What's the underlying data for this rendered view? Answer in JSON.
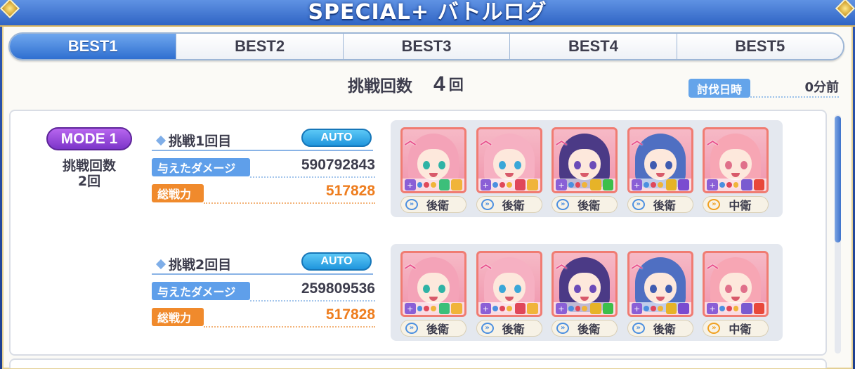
{
  "header": {
    "title": "SPECIAL+ バトルログ"
  },
  "tabs": [
    {
      "label": "BEST1",
      "active": true
    },
    {
      "label": "BEST2",
      "active": false
    },
    {
      "label": "BEST3",
      "active": false
    },
    {
      "label": "BEST4",
      "active": false
    },
    {
      "label": "BEST5",
      "active": false
    }
  ],
  "summary": {
    "attempts_label": "挑戦回数",
    "attempts_value": "4",
    "attempts_unit": "回",
    "date_label": "討伐日時",
    "date_value": "0分前"
  },
  "mode": {
    "badge": "MODE 1",
    "count_label": "挑戦回数",
    "count_value": "2回"
  },
  "runs": [
    {
      "title": "挑戦1回目",
      "auto_label": "AUTO",
      "damage_label": "与えたダメージ",
      "damage_value": "590792843",
      "power_label": "総戦力",
      "power_value": "517828",
      "party": [
        {
          "position": "後衛",
          "hair": "#f4a3b8",
          "eyes": "#2fb3a5",
          "icons": [
            "chat-heart",
            "sun"
          ],
          "icon_colors": [
            "#3cbf7a",
            "#f0b43a"
          ],
          "arrow": "blue"
        },
        {
          "position": "後衛",
          "hair": "#f6b0c2",
          "eyes": "#3aa7d8",
          "icons": [
            "slash",
            "sun"
          ],
          "icon_colors": [
            "#e0475a",
            "#f0b43a"
          ],
          "arrow": "blue"
        },
        {
          "position": "後衛",
          "hair": "#4b3a86",
          "eyes": "#6b4bb8",
          "icons": [
            "flask",
            "wind"
          ],
          "icon_colors": [
            "#e6b328",
            "#3cbf4a"
          ],
          "arrow": "blue"
        },
        {
          "position": "後衛",
          "hair": "#4f6fc2",
          "eyes": "#3f5bb0",
          "icons": [
            "flask",
            "moon"
          ],
          "icon_colors": [
            "#e6b328",
            "#7a4bd0"
          ],
          "arrow": "blue"
        },
        {
          "position": "中衛",
          "hair": "#f7a6b4",
          "eyes": "#e0708a",
          "icons": [
            "shield",
            "fire"
          ],
          "icon_colors": [
            "#7a5bd0",
            "#e8483a"
          ],
          "arrow": "orange"
        }
      ]
    },
    {
      "title": "挑戦2回目",
      "auto_label": "AUTO",
      "damage_label": "与えたダメージ",
      "damage_value": "259809536",
      "power_label": "総戦力",
      "power_value": "517828",
      "party": [
        {
          "position": "後衛",
          "hair": "#f4a3b8",
          "eyes": "#2fb3a5",
          "icons": [
            "chat-heart",
            "sun"
          ],
          "icon_colors": [
            "#3cbf7a",
            "#f0b43a"
          ],
          "arrow": "blue"
        },
        {
          "position": "後衛",
          "hair": "#f6b0c2",
          "eyes": "#3aa7d8",
          "icons": [
            "slash",
            "sun"
          ],
          "icon_colors": [
            "#e0475a",
            "#f0b43a"
          ],
          "arrow": "blue"
        },
        {
          "position": "後衛",
          "hair": "#4b3a86",
          "eyes": "#6b4bb8",
          "icons": [
            "flask",
            "wind"
          ],
          "icon_colors": [
            "#e6b328",
            "#3cbf4a"
          ],
          "arrow": "blue"
        },
        {
          "position": "後衛",
          "hair": "#4f6fc2",
          "eyes": "#3f5bb0",
          "icons": [
            "flask",
            "moon"
          ],
          "icon_colors": [
            "#e6b328",
            "#7a4bd0"
          ],
          "arrow": "blue"
        },
        {
          "position": "中衛",
          "hair": "#f7a6b4",
          "eyes": "#e0708a",
          "icons": [
            "shield",
            "fire"
          ],
          "icon_colors": [
            "#7a5bd0",
            "#e8483a"
          ],
          "arrow": "orange"
        }
      ]
    }
  ],
  "colors": {
    "tab_active": "#2f6fd0",
    "mode_badge": "#7c35c9",
    "damage_tag": "#5f9fea",
    "power_tag": "#f08a2c",
    "auto_pill": "#1f95dd"
  }
}
